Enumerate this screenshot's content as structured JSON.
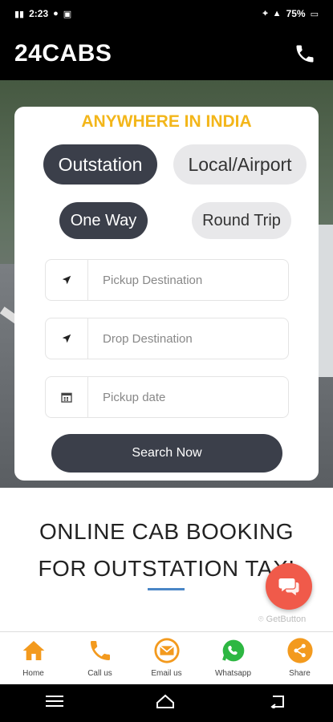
{
  "status_bar": {
    "time": "2:23",
    "battery": "75%"
  },
  "header": {
    "brand": "24CABS"
  },
  "card": {
    "title": "ANYWHERE IN INDIA",
    "trip_category": {
      "outstation": "Outstation",
      "local": "Local/Airport"
    },
    "trip_type": {
      "one_way": "One Way",
      "round_trip": "Round Trip"
    },
    "fields": {
      "pickup_placeholder": "Pickup Destination",
      "drop_placeholder": "Drop Destination",
      "date_placeholder": "Pickup date"
    },
    "search_label": "Search Now"
  },
  "headline": {
    "line1": "ONLINE CAB BOOKING",
    "line2": "FOR OUTSTATION TAXI"
  },
  "getbutton": "GetButton",
  "bottom_nav": {
    "home": "Home",
    "call": "Call us",
    "email": "Email us",
    "whatsapp": "Whatsapp",
    "share": "Share"
  },
  "colors": {
    "accent_yellow": "#f3b61a",
    "dark_pill": "#3b3f4a",
    "orange": "#f39a1e",
    "whatsapp": "#2db742",
    "chat_fab": "#f05a4a"
  }
}
